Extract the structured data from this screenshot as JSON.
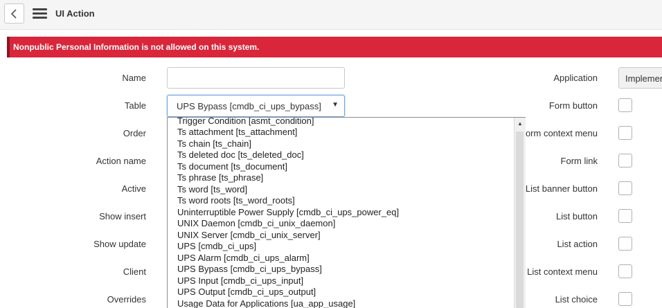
{
  "header": {
    "title": "UI Action"
  },
  "banner": {
    "text": "Nonpublic Personal Information is not allowed on this system."
  },
  "form": {
    "left_labels": [
      "Name",
      "Table",
      "Order",
      "Action name",
      "Active",
      "Show insert",
      "Show update",
      "Client",
      "Overrides"
    ],
    "table_value": "UPS Bypass [cmdb_ci_ups_bypass]",
    "name_value": "",
    "right_labels": [
      "Application",
      "Form button",
      "Form context menu",
      "Form link",
      "List banner button",
      "List button",
      "List action",
      "List context menu",
      "List choice"
    ],
    "application_value": "Implementation"
  },
  "dropdown": {
    "options": [
      "Trigger Condition [asmt_condition]",
      "Ts attachment [ts_attachment]",
      "Ts chain [ts_chain]",
      "Ts deleted doc [ts_deleted_doc]",
      "Ts document [ts_document]",
      "Ts phrase [ts_phrase]",
      "Ts word [ts_word]",
      "Ts word roots [ts_word_roots]",
      "Uninterruptible Power Supply [cmdb_ci_ups_power_eq]",
      "UNIX Daemon [cmdb_ci_unix_daemon]",
      "UNIX Server [cmdb_ci_unix_server]",
      "UPS [cmdb_ci_ups]",
      "UPS Alarm [cmdb_ci_ups_alarm]",
      "UPS Bypass [cmdb_ci_ups_bypass]",
      "UPS Input [cmdb_ci_ups_input]",
      "UPS Output [cmdb_ci_ups_output]",
      "Usage Data for Applications [ua_app_usage]"
    ]
  },
  "colors": {
    "banner": "#d9263a",
    "banner_border": "#8a1524",
    "focus": "#6ea3d8"
  },
  "icons": {
    "back": "chevron-left-icon",
    "menu": "hamburger-menu-icon",
    "select_arrow": "caret-down-icon",
    "scroll_up": "scroll-up-arrow-icon"
  }
}
